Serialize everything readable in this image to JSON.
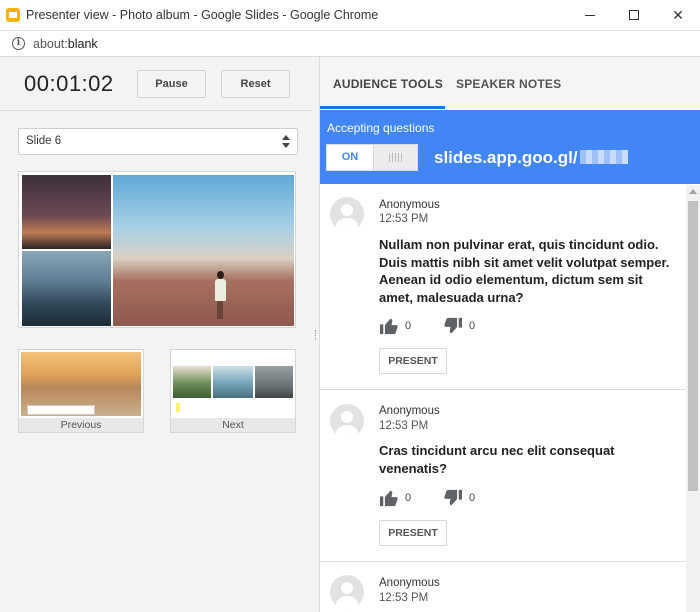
{
  "window": {
    "title": "Presenter view - Photo album - Google Slides - Google Chrome",
    "minimize_icon": "minimize-icon",
    "maximize_icon": "maximize-icon",
    "close_glyph": "✕"
  },
  "address": {
    "scheme": "about:",
    "path": "blank",
    "icon": "info-icon"
  },
  "presenter": {
    "timer": "00:01:02",
    "pause_label": "Pause",
    "reset_label": "Reset",
    "slide_selected": "Slide 6",
    "previous_label": "Previous",
    "next_label": "Next"
  },
  "tabs": [
    {
      "label": "AUDIENCE TOOLS",
      "active": true
    },
    {
      "label": "SPEAKER NOTES",
      "active": false
    }
  ],
  "qa": {
    "caption": "Accepting questions",
    "toggle_on": "ON",
    "url": "slides.app.goo.gl/"
  },
  "questions": [
    {
      "author": "Anonymous",
      "time": "12:53 PM",
      "text": "Nullam non pulvinar erat, quis tincidunt odio. Duis mattis nibh sit amet velit volutpat semper. Aenean id odio elementum, dictum sem sit amet, malesuada urna?",
      "upvotes": "0",
      "downvotes": "0",
      "present_label": "PRESENT"
    },
    {
      "author": "Anonymous",
      "time": "12:53 PM",
      "text": "Cras tincidunt arcu nec elit consequat venenatis?",
      "upvotes": "0",
      "downvotes": "0",
      "present_label": "PRESENT"
    },
    {
      "author": "Anonymous",
      "time": "12:53 PM"
    }
  ],
  "colors": {
    "accent": "#4285f4",
    "tab_underline": "#1a73e8"
  }
}
